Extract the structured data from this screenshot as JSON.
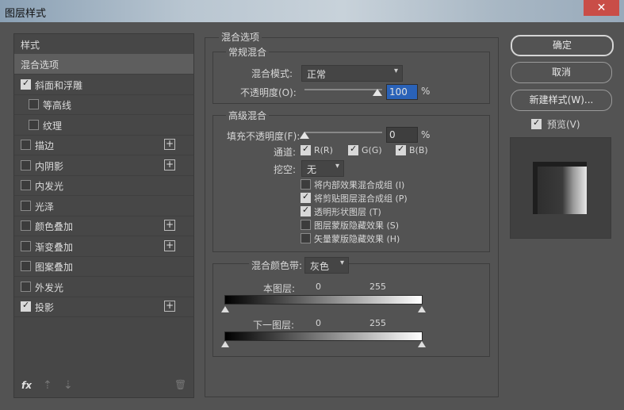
{
  "window": {
    "title": "图层样式",
    "close": "✕"
  },
  "left_panel": {
    "header": "样式",
    "items": [
      {
        "label": "混合选项",
        "checkbox": false,
        "checked": false,
        "plus": false,
        "selected": true
      },
      {
        "label": "斜面和浮雕",
        "checkbox": true,
        "checked": true,
        "plus": false,
        "selected": false
      },
      {
        "label": "等高线",
        "checkbox": true,
        "checked": false,
        "plus": false,
        "selected": false,
        "indent": true
      },
      {
        "label": "纹理",
        "checkbox": true,
        "checked": false,
        "plus": false,
        "selected": false,
        "indent": true
      },
      {
        "label": "描边",
        "checkbox": true,
        "checked": false,
        "plus": true,
        "selected": false
      },
      {
        "label": "内阴影",
        "checkbox": true,
        "checked": false,
        "plus": true,
        "selected": false
      },
      {
        "label": "内发光",
        "checkbox": true,
        "checked": false,
        "plus": false,
        "selected": false
      },
      {
        "label": "光泽",
        "checkbox": true,
        "checked": false,
        "plus": false,
        "selected": false
      },
      {
        "label": "颜色叠加",
        "checkbox": true,
        "checked": false,
        "plus": true,
        "selected": false
      },
      {
        "label": "渐变叠加",
        "checkbox": true,
        "checked": false,
        "plus": true,
        "selected": false
      },
      {
        "label": "图案叠加",
        "checkbox": true,
        "checked": false,
        "plus": false,
        "selected": false
      },
      {
        "label": "外发光",
        "checkbox": true,
        "checked": false,
        "plus": false,
        "selected": false
      },
      {
        "label": "投影",
        "checkbox": true,
        "checked": true,
        "plus": true,
        "selected": false
      }
    ],
    "footer": {
      "fx": "fx",
      "up": "⇡",
      "down": "⇣",
      "trash": "🗑"
    }
  },
  "blend": {
    "title": "混合选项",
    "general": {
      "title": "常规混合",
      "mode_label": "混合模式:",
      "mode_value": "正常",
      "opacity_label": "不透明度(O):",
      "opacity_value": "100",
      "opacity_unit": "%",
      "opacity_level": 1.0
    },
    "advanced": {
      "title": "高级混合",
      "fill_label": "填充不透明度(F):",
      "fill_value": "0",
      "fill_unit": "%",
      "fill_level": 0.0,
      "channels_label": "通道:",
      "channels": [
        {
          "label": "R(R)",
          "checked": true
        },
        {
          "label": "G(G)",
          "checked": true
        },
        {
          "label": "B(B)",
          "checked": true
        }
      ],
      "knockout_label": "挖空:",
      "knockout_value": "无",
      "options": [
        {
          "label": "将内部效果混合成组 (I)",
          "checked": false
        },
        {
          "label": "将剪贴图层混合成组 (P)",
          "checked": true
        },
        {
          "label": "透明形状图层 (T)",
          "checked": true
        },
        {
          "label": "图层蒙版隐藏效果 (S)",
          "checked": false
        },
        {
          "label": "矢量蒙版隐藏效果 (H)",
          "checked": false
        }
      ]
    },
    "blend_if": {
      "label": "混合颜色带:",
      "value": "灰色",
      "this_layer": {
        "label": "本图层:",
        "low": "0",
        "high": "255"
      },
      "underlying": {
        "label": "下一图层:",
        "low": "0",
        "high": "255"
      }
    }
  },
  "buttons": {
    "ok": "确定",
    "cancel": "取消",
    "new_style": "新建样式(W)...",
    "preview_label": "预览(V)",
    "preview_checked": true
  }
}
